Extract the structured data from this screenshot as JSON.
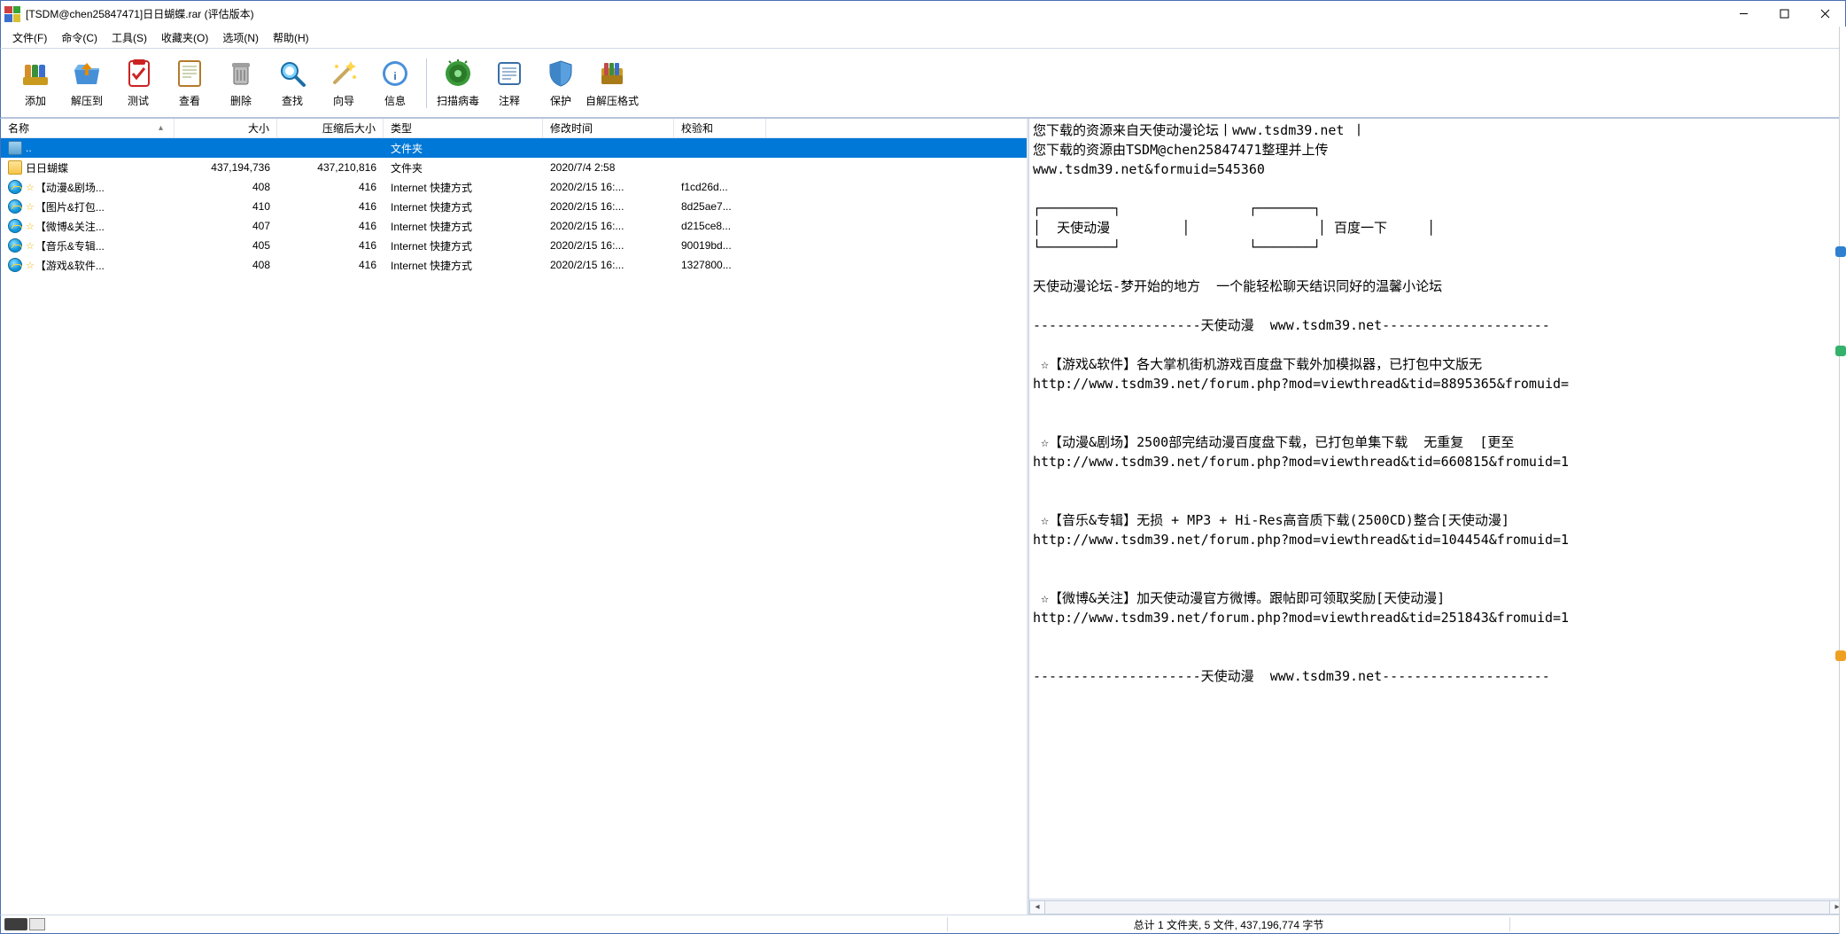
{
  "title": "[TSDM@chen25847471]日日蝴蝶.rar (评估版本)",
  "menu": [
    "文件(F)",
    "命令(C)",
    "工具(S)",
    "收藏夹(O)",
    "选项(N)",
    "帮助(H)"
  ],
  "toolbar": [
    {
      "id": "add",
      "label": "添加"
    },
    {
      "id": "extract",
      "label": "解压到"
    },
    {
      "id": "test",
      "label": "测试"
    },
    {
      "id": "view",
      "label": "查看"
    },
    {
      "id": "delete",
      "label": "删除"
    },
    {
      "id": "find",
      "label": "查找"
    },
    {
      "id": "wizard",
      "label": "向导"
    },
    {
      "id": "info",
      "label": "信息"
    },
    {
      "sep": true
    },
    {
      "id": "scan",
      "label": "扫描病毒"
    },
    {
      "id": "comment",
      "label": "注释"
    },
    {
      "id": "protect",
      "label": "保护"
    },
    {
      "id": "sfx",
      "label": "自解压格式"
    }
  ],
  "columns": [
    {
      "key": "name",
      "label": "名称",
      "w": "c-name",
      "sort": true
    },
    {
      "key": "size",
      "label": "大小",
      "w": "c-size",
      "align": "num"
    },
    {
      "key": "packed",
      "label": "压缩后大小",
      "w": "c-pack",
      "align": "num"
    },
    {
      "key": "type",
      "label": "类型",
      "w": "c-type"
    },
    {
      "key": "mod",
      "label": "修改时间",
      "w": "c-mod"
    },
    {
      "key": "crc",
      "label": "校验和",
      "w": "c-crc"
    }
  ],
  "rows": [
    {
      "icon": "up",
      "name": "..",
      "type": "文件夹",
      "selected": true
    },
    {
      "icon": "folder",
      "name": "日日蝴蝶",
      "size": "437,194,736",
      "packed": "437,210,816",
      "type": "文件夹",
      "mod": "2020/7/4 2:58"
    },
    {
      "icon": "ie",
      "star": true,
      "name": "【动漫&剧场...",
      "size": "408",
      "packed": "416",
      "type": "Internet 快捷方式",
      "mod": "2020/2/15 16:...",
      "crc": "f1cd26d..."
    },
    {
      "icon": "ie",
      "star": true,
      "name": "【图片&打包...",
      "size": "410",
      "packed": "416",
      "type": "Internet 快捷方式",
      "mod": "2020/2/15 16:...",
      "crc": "8d25ae7..."
    },
    {
      "icon": "ie",
      "star": true,
      "name": "【微博&关注...",
      "size": "407",
      "packed": "416",
      "type": "Internet 快捷方式",
      "mod": "2020/2/15 16:...",
      "crc": "d215ce8..."
    },
    {
      "icon": "ie",
      "star": true,
      "name": "【音乐&专辑...",
      "size": "405",
      "packed": "416",
      "type": "Internet 快捷方式",
      "mod": "2020/2/15 16:...",
      "crc": "90019bd..."
    },
    {
      "icon": "ie",
      "star": true,
      "name": "【游戏&软件...",
      "size": "408",
      "packed": "416",
      "type": "Internet 快捷方式",
      "mod": "2020/2/15 16:...",
      "crc": "1327800..."
    }
  ],
  "preview_lines": [
    "您下载的资源来自天使动漫论坛丨www.tsdm39.net 丨",
    "您下载的资源由TSDM@chen25847471整理并上传",
    "www.tsdm39.net&formuid=545360",
    "",
    "┌─────────┐                ┌───────┐",
    "│  天使动漫         │                │ 百度一下     │",
    "└─────────┘                └───────┘",
    "",
    "天使动漫论坛-梦开始的地方  一个能轻松聊天结识同好的温馨小论坛",
    "",
    "---------------------天使动漫  www.tsdm39.net---------------------",
    "",
    " ☆【游戏&软件】各大掌机街机游戏百度盘下载外加模拟器，已打包中文版无",
    "http://www.tsdm39.net/forum.php?mod=viewthread&tid=8895365&fromuid=",
    "",
    "",
    " ☆【动漫&剧场】2500部完结动漫百度盘下载，已打包单集下载  无重复  [更至",
    "http://www.tsdm39.net/forum.php?mod=viewthread&tid=660815&fromuid=1",
    "",
    "",
    " ☆【音乐&专辑】无损 + MP3 + Hi-Res高音质下载(2500CD)整合[天使动漫]",
    "http://www.tsdm39.net/forum.php?mod=viewthread&tid=104454&fromuid=1",
    "",
    "",
    " ☆【微博&关注】加天使动漫官方微博。跟帖即可领取奖励[天使动漫]",
    "http://www.tsdm39.net/forum.php?mod=viewthread&tid=251843&fromuid=1",
    "",
    "",
    "---------------------天使动漫  www.tsdm39.net---------------------"
  ],
  "status": "总计 1 文件夹, 5 文件, 437,196,774 字节"
}
